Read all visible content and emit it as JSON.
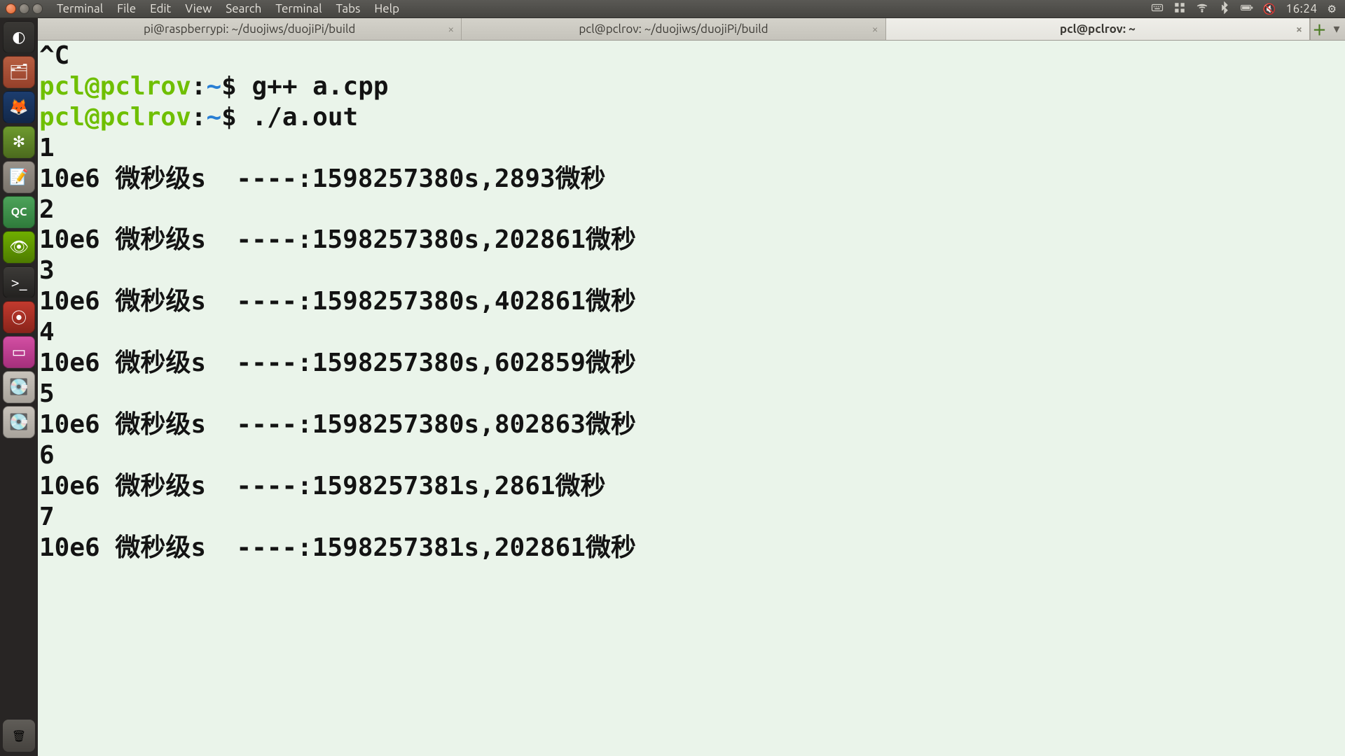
{
  "menubar": {
    "app": "Terminal",
    "items": [
      "File",
      "Edit",
      "View",
      "Search",
      "Terminal",
      "Tabs",
      "Help"
    ],
    "clock": "16:24"
  },
  "tabs": [
    {
      "title": "pi@raspberrypi: ~/duojiws/duojiPi/build",
      "active": false
    },
    {
      "title": "pcl@pclrov: ~/duojiws/duojiPi/build",
      "active": false
    },
    {
      "title": "pcl@pclrov: ~",
      "active": true
    }
  ],
  "prompt": {
    "user_host": "pcl@pclrov",
    "sep1": ":",
    "path": "~",
    "dollar": "$"
  },
  "lines": {
    "ctrl_c": "^C",
    "cmd1": " g++ a.cpp",
    "cmd2": " ./a.out",
    "out": [
      "1",
      "10e6 微秒级s  ----:1598257380s,2893微秒",
      "2",
      "10e6 微秒级s  ----:1598257380s,202861微秒",
      "3",
      "10e6 微秒级s  ----:1598257380s,402861微秒",
      "4",
      "10e6 微秒级s  ----:1598257380s,602859微秒",
      "5",
      "10e6 微秒级s  ----:1598257380s,802863微秒",
      "6",
      "10e6 微秒级s  ----:1598257381s,2861微秒",
      "7",
      "10e6 微秒级s  ----:1598257381s,202861微秒"
    ]
  }
}
